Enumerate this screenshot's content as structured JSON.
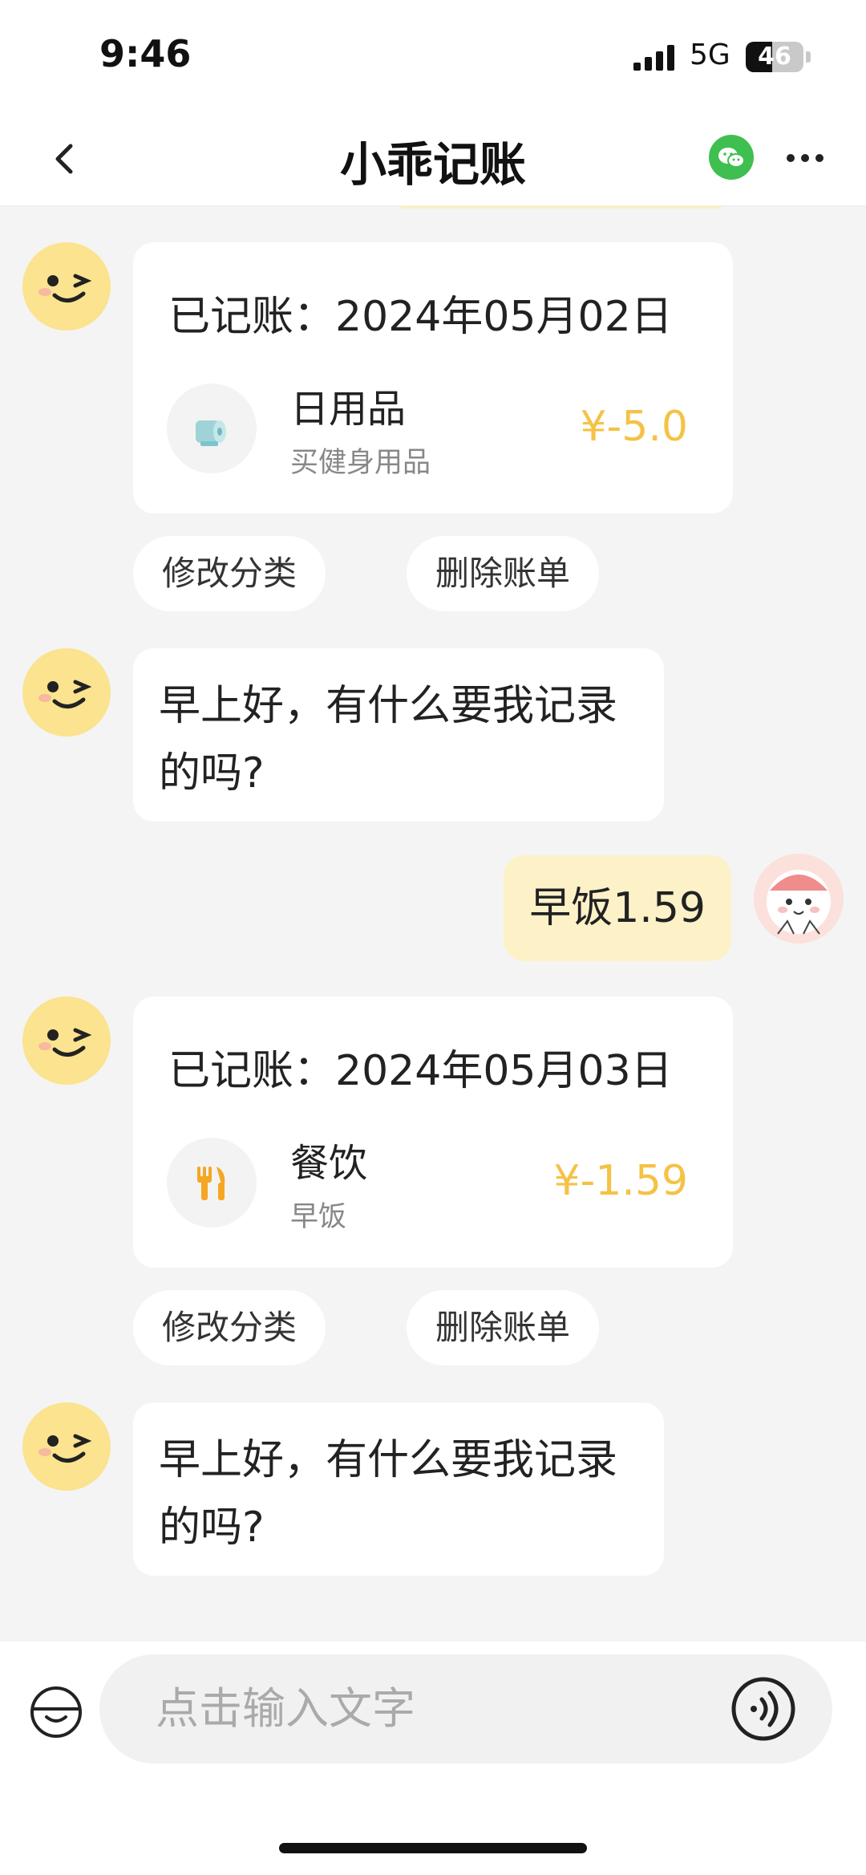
{
  "status_bar": {
    "time": "9:46",
    "network": "5G",
    "battery": "46"
  },
  "header": {
    "title": "小乖记账"
  },
  "colors": {
    "accent_amount": "#f5c245",
    "user_bubble": "#fdf1c8",
    "wechat_green": "#3fbf4f"
  },
  "messages": {
    "record1": {
      "head": "已记账：2024年05月02日",
      "category": "日用品",
      "note": "买健身用品",
      "amount": "¥-5.0",
      "icon": "toilet-paper-icon"
    },
    "actions1": {
      "edit": "修改分类",
      "delete": "删除账单"
    },
    "greeting1": "早上好，有什么要我记录的吗?",
    "user1": "早饭1.59",
    "record2": {
      "head": "已记账：2024年05月03日",
      "category": "餐饮",
      "note": "早饭",
      "amount": "¥-1.59",
      "icon": "fork-knife-icon"
    },
    "actions2": {
      "edit": "修改分类",
      "delete": "删除账单"
    },
    "greeting2": "早上好，有什么要我记录的吗?"
  },
  "input": {
    "placeholder": "点击输入文字"
  }
}
